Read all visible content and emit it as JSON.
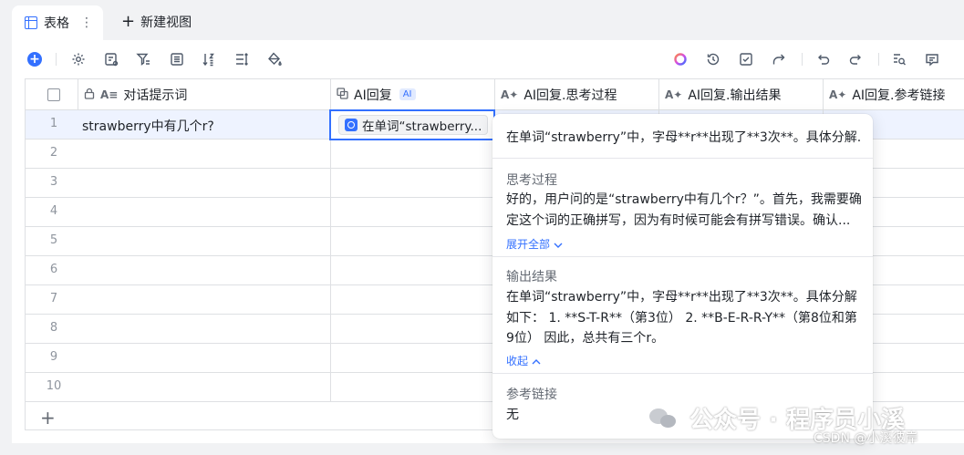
{
  "tabs": {
    "active_label": "表格",
    "more_label": "⋮",
    "new_view_label": "新建视图"
  },
  "toolbar": {
    "add_symbol": "+",
    "left_icons": [
      "settings-icon",
      "form-icon",
      "filter-icon",
      "list-icon",
      "sort-icon",
      "row-height-icon",
      "fill-color-icon"
    ],
    "right_icons": [
      "ai-ring-icon",
      "history-icon",
      "checklist-icon",
      "share-icon",
      "undo-icon",
      "redo-icon",
      "find-icon",
      "comment-icon"
    ]
  },
  "grid": {
    "columns": [
      {
        "label": "对话提示词",
        "icon": "lock-text-icon"
      },
      {
        "label": "AI回复",
        "tag": "AI",
        "icon": "ai-copy-icon"
      },
      {
        "label": "AI回复.思考过程",
        "icon": "ai-text-icon"
      },
      {
        "label": "AI回复.输出结果",
        "icon": "ai-text-icon"
      },
      {
        "label": "AI回复.参考链接",
        "icon": "ai-text-icon"
      }
    ],
    "rows": [
      {
        "num": "1",
        "prompt": "strawberry中有几个r?",
        "ai_reply": "在单词“strawberry..."
      },
      {
        "num": "2",
        "prompt": ""
      },
      {
        "num": "3",
        "prompt": ""
      },
      {
        "num": "4",
        "prompt": ""
      },
      {
        "num": "5",
        "prompt": ""
      },
      {
        "num": "6",
        "prompt": ""
      },
      {
        "num": "7",
        "prompt": ""
      },
      {
        "num": "8",
        "prompt": ""
      },
      {
        "num": "9",
        "prompt": ""
      },
      {
        "num": "10",
        "prompt": ""
      }
    ],
    "add_row_symbol": "+"
  },
  "popover": {
    "summary": "在单词“strawberry”中，字母**r**出现了**3次**。具体分解...",
    "thinking_title": "思考过程",
    "thinking_text": "好的，用户问的是“strawberry中有几个r？”。首先，我需要确定这个词的正确拼写，因为有时候可能会有拼写错误。确认...",
    "expand_label": "展开全部",
    "output_title": "输出结果",
    "output_text": "在单词“strawberry”中，字母**r**出现了**3次**。具体分解如下： 1. **S-T-R**（第3位） 2. **B-E-R-R-Y**（第8位和第9位） 因此，总共有三个r。",
    "collapse_label": "收起",
    "links_title": "参考链接",
    "links_text": "无"
  },
  "watermark": {
    "text": "公众号 · 程序员小溪",
    "csdn": "CSDN @小溪彼岸"
  },
  "colors": {
    "accent": "#3370ff",
    "selected_row": "#eef3ff",
    "border": "#dee0e3"
  }
}
